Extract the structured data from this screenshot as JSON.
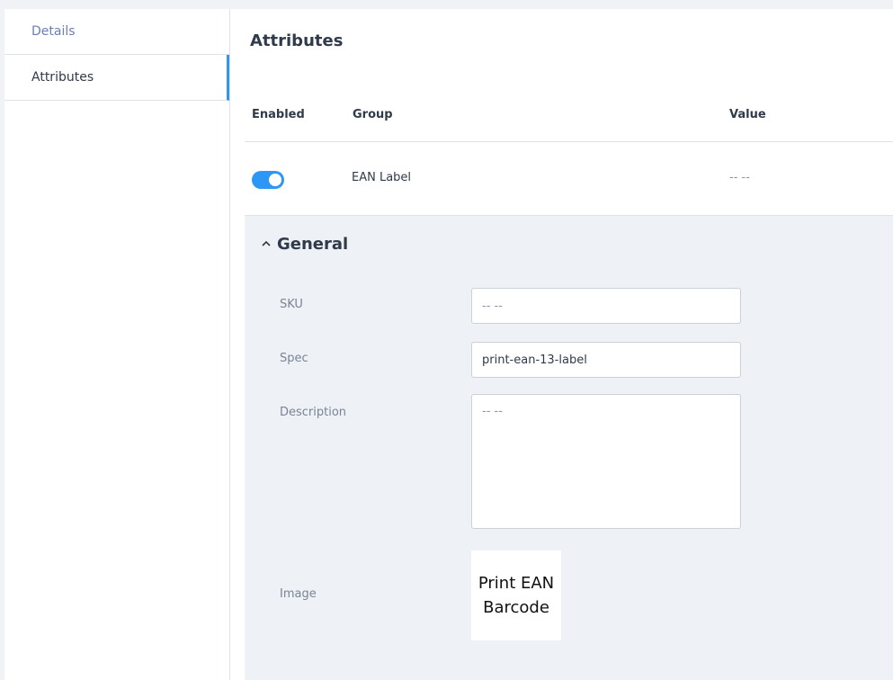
{
  "sidebar": {
    "items": [
      {
        "label": "Details"
      },
      {
        "label": "Attributes"
      }
    ]
  },
  "main": {
    "title": "Attributes",
    "table": {
      "headers": [
        "Enabled",
        "Group",
        "Value"
      ],
      "rows": [
        {
          "enabled": true,
          "group": "EAN Label",
          "value": "-- --"
        }
      ]
    }
  },
  "panel": {
    "section_title": "General",
    "icons": {
      "collapse": "chevron-up-icon"
    },
    "fields": {
      "sku": {
        "label": "SKU",
        "value": "",
        "placeholder": "-- --"
      },
      "spec": {
        "label": "Spec",
        "value": "print-ean-13-label"
      },
      "description": {
        "label": "Description",
        "value": "",
        "placeholder": "-- --"
      },
      "image": {
        "label": "Image",
        "image_text": "Print EAN\nBarcode"
      }
    }
  },
  "colors": {
    "accent": "#2c97f4",
    "panel_bg": "#eef1f5",
    "border": "#dfe3e8"
  }
}
